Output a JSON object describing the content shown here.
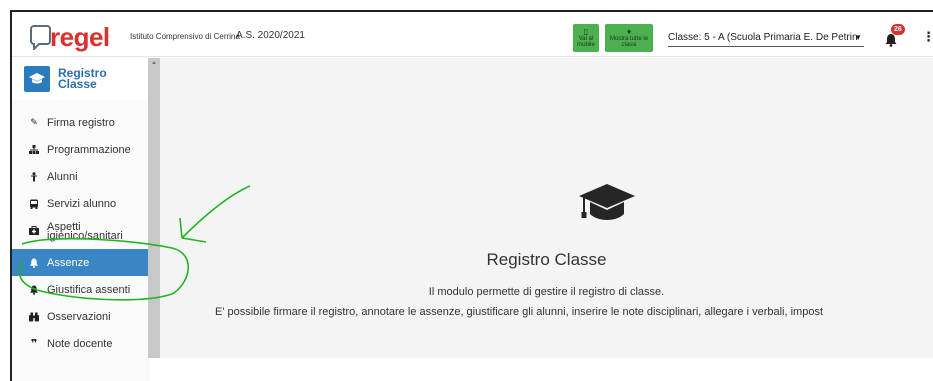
{
  "header": {
    "logo_text": "regel",
    "school_name": "Istituto Comprensivo di Cerrina",
    "school_year": "A.S. 2020/2021",
    "btn_mobile_label": "Vai al mobile",
    "btn_classi_label": "Mostra tutte le classi",
    "class_label": "Classe:",
    "class_value": "5 - A (Scuola Primaria E. De Petrin",
    "notification_count": "26"
  },
  "sidebar": {
    "title": "Registro Classe",
    "items": [
      {
        "label": "Firma registro",
        "icon": "edit-icon"
      },
      {
        "label": "Programmazione",
        "icon": "sitemap-icon"
      },
      {
        "label": "Alunni",
        "icon": "child-icon"
      },
      {
        "label": "Servizi alunno",
        "icon": "bus-icon"
      },
      {
        "label": "Aspetti igienico/sanitari",
        "icon": "medkit-icon"
      },
      {
        "label": "Assenze",
        "icon": "bell-icon",
        "active": true
      },
      {
        "label": "Giustifica assenti",
        "icon": "bell-icon"
      },
      {
        "label": "Osservazioni",
        "icon": "binoculars-icon"
      },
      {
        "label": "Note docente",
        "icon": "quote-icon"
      }
    ]
  },
  "main": {
    "title": "Registro Classe",
    "line1": "Il modulo permette di gestire il registro di classe.",
    "line2": "E' possibile firmare il registro, annotare le assenze, giustificare gli alunni, inserire le note disciplinari, allegare i verbali, impost"
  },
  "colors": {
    "brand_red": "#d9322e",
    "brand_blue": "#2b7bbf",
    "active_item": "#3a86c4",
    "action_green": "#4caf50",
    "annotation_green": "#22b422"
  }
}
